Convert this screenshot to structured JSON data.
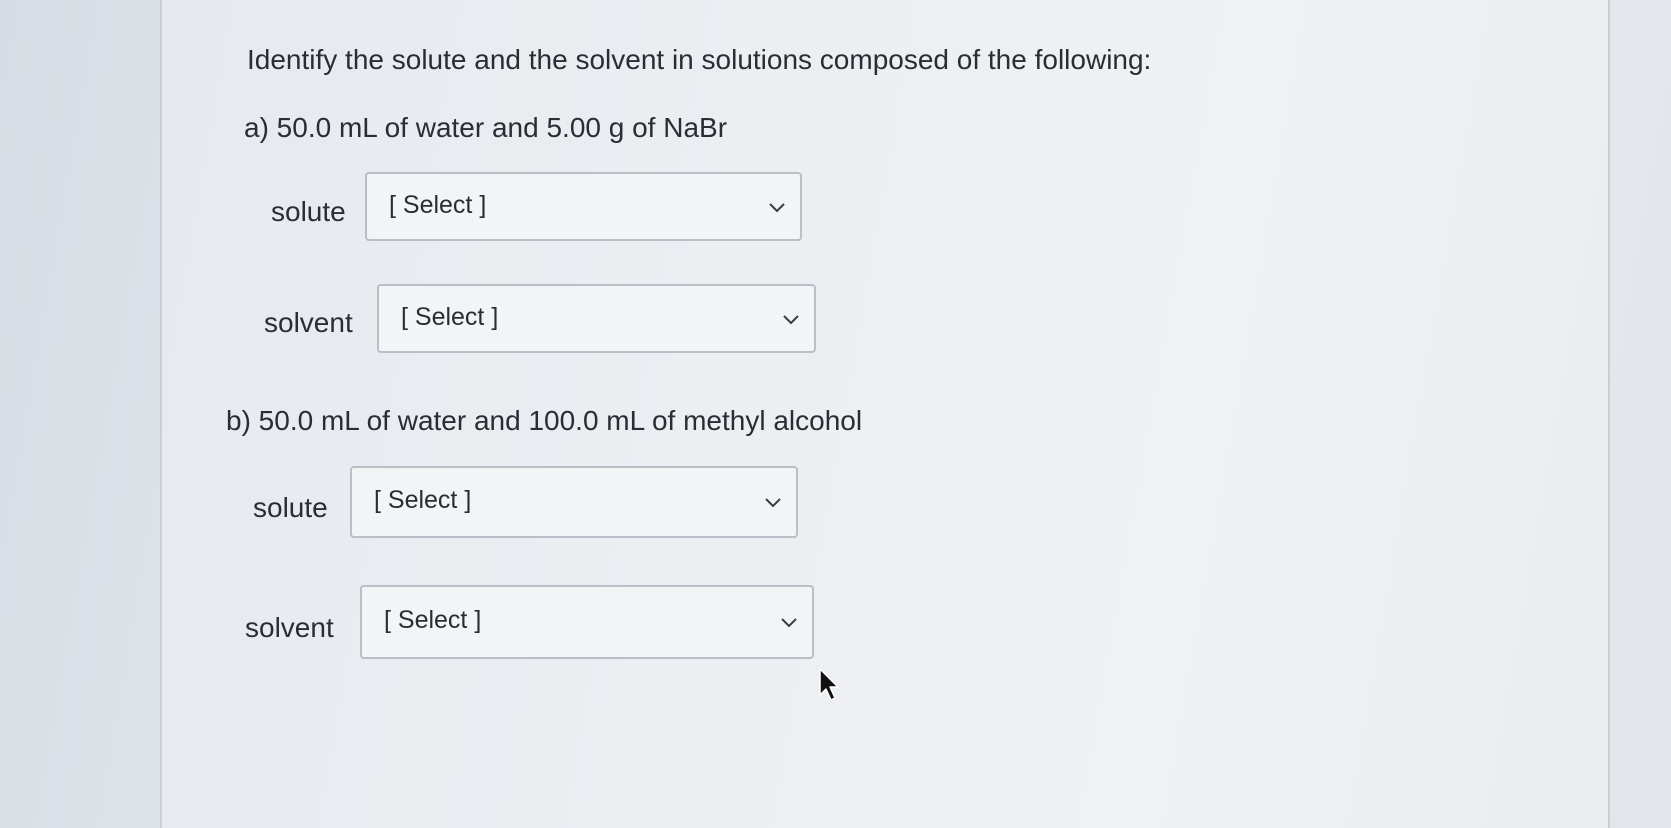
{
  "question": "Identify the solute and the solvent in solutions composed of the following:",
  "parts": [
    {
      "label": "a)  50.0 mL of water and 5.00 g of NaBr",
      "fields": [
        {
          "label": "solute",
          "value": "[ Select ]"
        },
        {
          "label": "solvent",
          "value": "[ Select ]"
        }
      ]
    },
    {
      "label": "b)  50.0 mL of water and 100.0 mL of methyl alcohol",
      "fields": [
        {
          "label": "solute",
          "value": "[ Select ]"
        },
        {
          "label": "solvent",
          "value": "[ Select ]"
        }
      ]
    }
  ],
  "icons": {
    "dropdown": "chevron-down-icon",
    "pointer": "mouse-pointer-icon"
  },
  "colors": {
    "text": "#2a2d33",
    "select_border": "#b9bfc8",
    "select_bg": "#f2f4f6"
  }
}
